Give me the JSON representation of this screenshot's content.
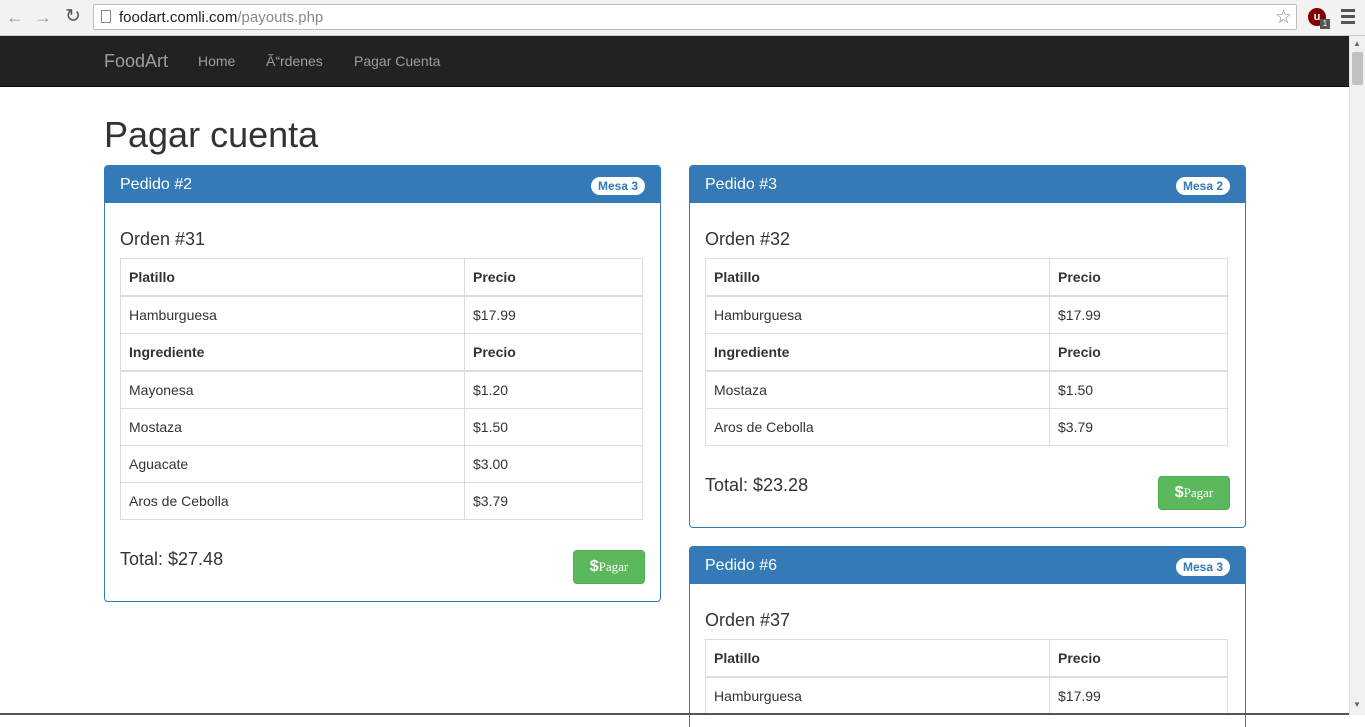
{
  "browser": {
    "url_host": "foodart.comli.com",
    "url_path": "/payouts.php",
    "extension_badge": "1",
    "extension_letter": "u"
  },
  "navbar": {
    "brand": "FoodArt",
    "links": [
      "Home",
      "Ã“rdenes",
      "Pagar Cuenta"
    ]
  },
  "page_title": "Pagar cuenta",
  "pedidos": [
    {
      "title": "Pedido #2",
      "mesa": "Mesa 3",
      "orden": "Orden #31",
      "header": [
        "Platillo",
        "Precio"
      ],
      "platillo": [
        "Hamburguesa",
        "$17.99"
      ],
      "ing_header": [
        "Ingrediente",
        "Precio"
      ],
      "ingredientes": [
        [
          "Mayonesa",
          "$1.20"
        ],
        [
          "Mostaza",
          "$1.50"
        ],
        [
          "Aguacate",
          "$3.00"
        ],
        [
          "Aros de Cebolla",
          "$3.79"
        ]
      ],
      "total": "Total: $27.48",
      "pay_symbol": "$",
      "pay_label": "Pagar"
    },
    {
      "title": "Pedido #3",
      "mesa": "Mesa 2",
      "orden": "Orden #32",
      "header": [
        "Platillo",
        "Precio"
      ],
      "platillo": [
        "Hamburguesa",
        "$17.99"
      ],
      "ing_header": [
        "Ingrediente",
        "Precio"
      ],
      "ingredientes": [
        [
          "Mostaza",
          "$1.50"
        ],
        [
          "Aros de Cebolla",
          "$3.79"
        ]
      ],
      "total": "Total: $23.28",
      "pay_symbol": "$",
      "pay_label": "Pagar"
    },
    {
      "title": "Pedido #6",
      "mesa": "Mesa 3",
      "orden": "Orden #37",
      "header": [
        "Platillo",
        "Precio"
      ],
      "platillo": [
        "Hamburguesa",
        "$17.99"
      ]
    }
  ]
}
